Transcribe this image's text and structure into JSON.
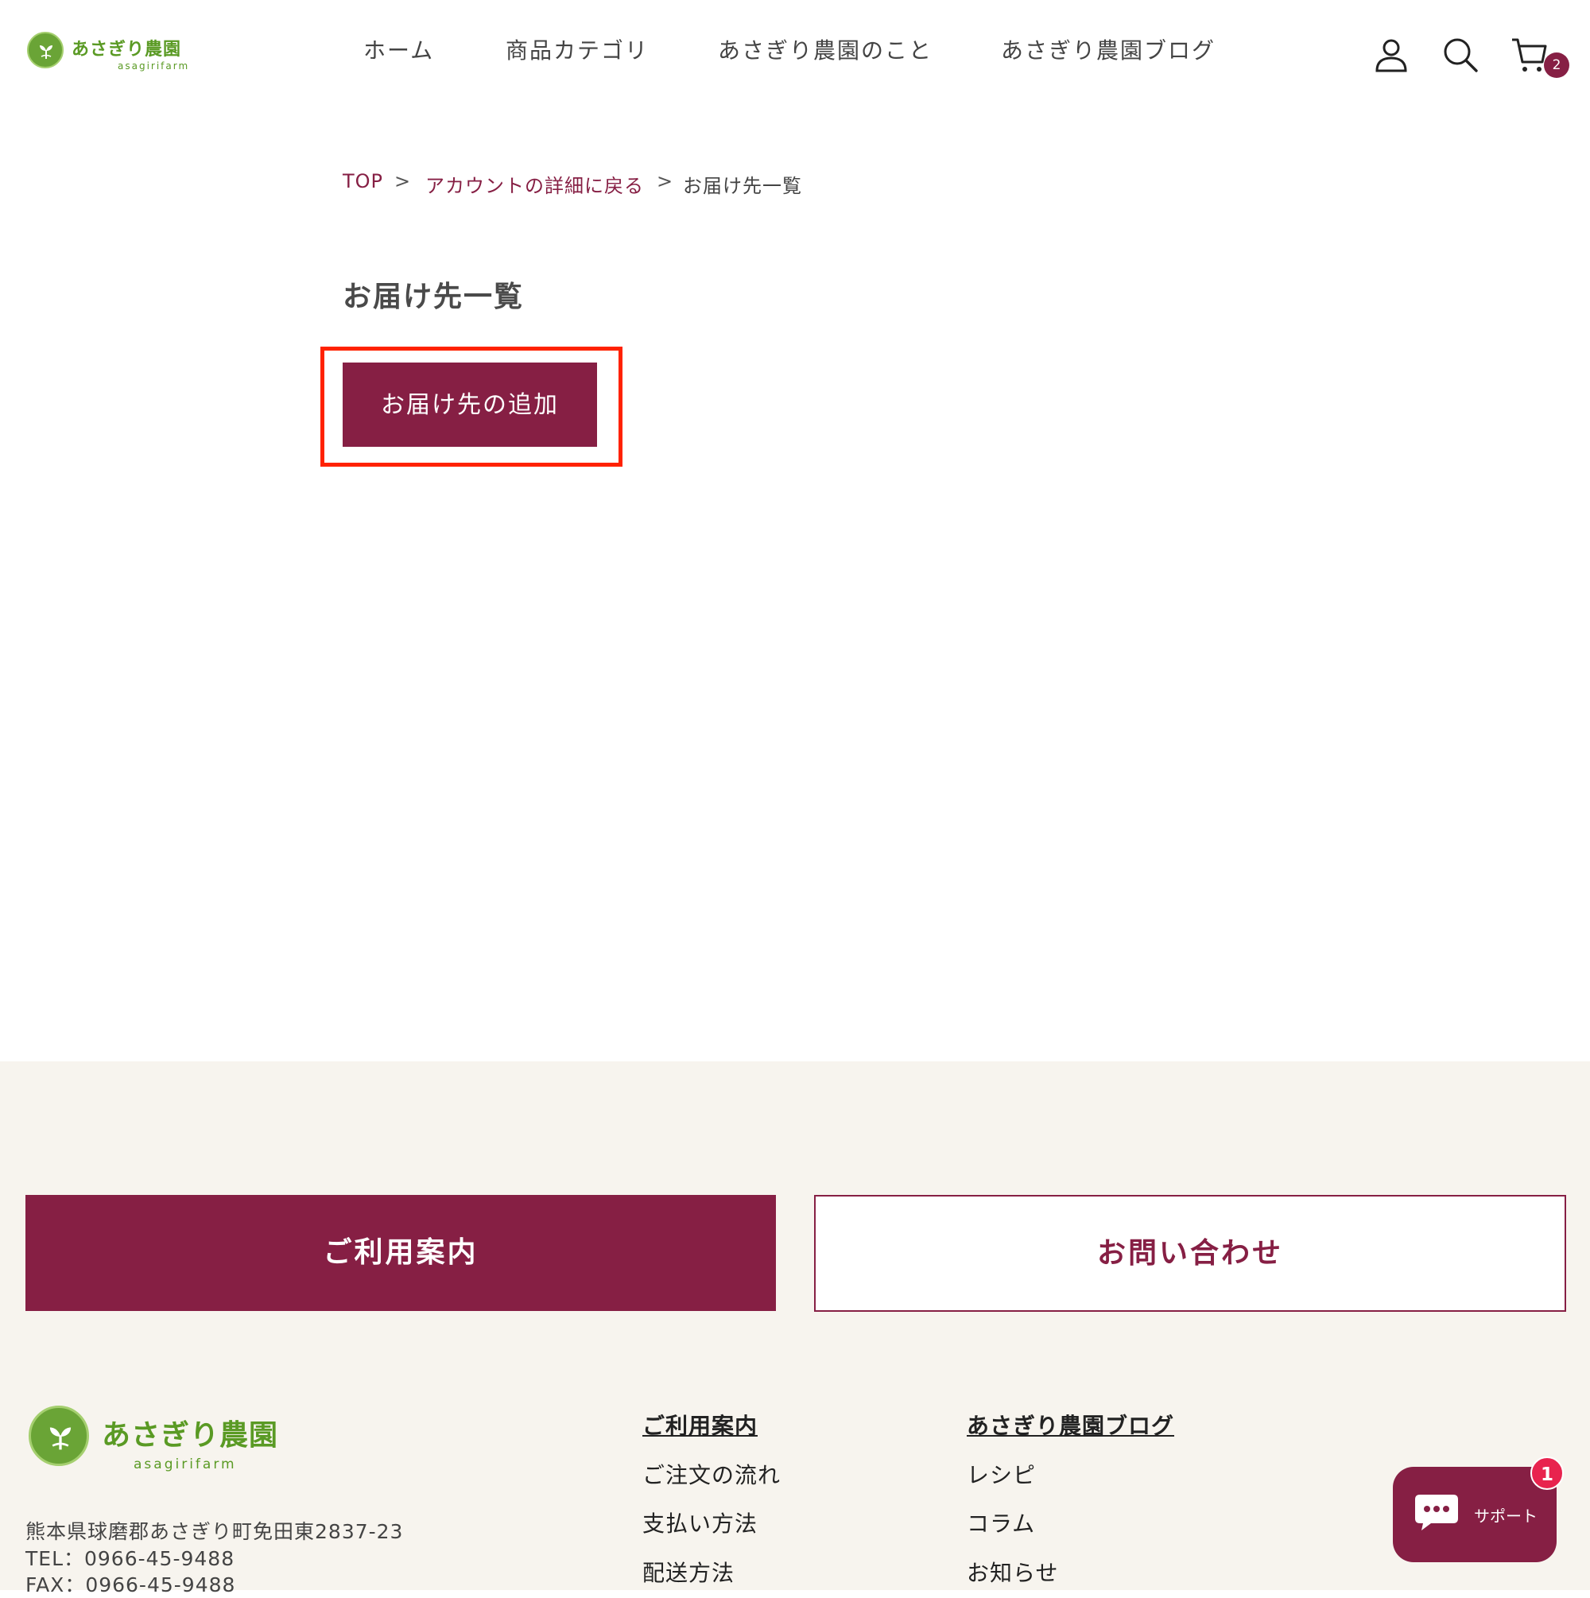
{
  "header": {
    "logo_text": "あさぎり農園",
    "logo_sub": "asagirifarm",
    "nav": [
      {
        "label": "ホーム"
      },
      {
        "label": "商品カテゴリ"
      },
      {
        "label": "あさぎり農園のこと"
      },
      {
        "label": "あさぎり農園ブログ"
      }
    ],
    "cart_count": "2"
  },
  "breadcrumb": {
    "top": "TOP",
    "sep": ">",
    "account": "アカウントの詳細に戻る",
    "current": "お届け先一覧"
  },
  "main": {
    "title": "お届け先一覧",
    "add_button": "お届け先の追加"
  },
  "footer": {
    "guide_button": "ご利用案内",
    "contact_button": "お問い合わせ",
    "logo_text": "あさぎり農園",
    "logo_sub": "asagirifarm",
    "address": "熊本県球磨郡あさぎり町免田東2837-23",
    "tel": "TEL：0966-45-9488",
    "fax": "FAX：0966-45-9488",
    "col1": {
      "heading": "ご利用案内",
      "links": [
        "ご注文の流れ",
        "支払い方法",
        "配送方法"
      ]
    },
    "col2": {
      "heading": "あさぎり農園ブログ",
      "links": [
        "レシピ",
        "コラム",
        "お知らせ"
      ]
    }
  },
  "support": {
    "label": "サポート",
    "badge": "1"
  },
  "colors": {
    "brand": "#861f44",
    "logo_green": "#5a9a24",
    "footer_bg": "#f7f4ee",
    "highlight": "#ff2200"
  }
}
